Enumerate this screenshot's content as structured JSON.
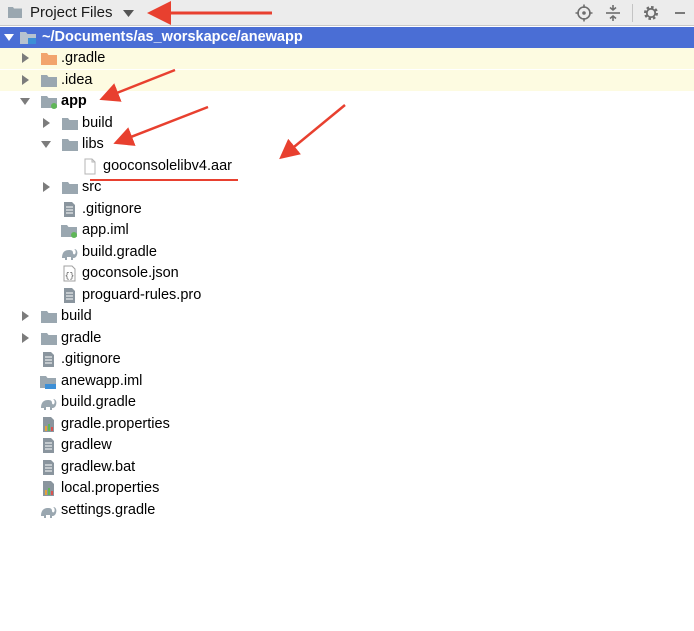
{
  "toolbar": {
    "title": "Project Files",
    "icons": [
      "folder-icon",
      "chevron-down-icon",
      "locate-icon",
      "collapse-all-icon",
      "gear-icon",
      "hide-icon"
    ]
  },
  "tree": {
    "root": "~/Documents/as_worskapce/anewapp",
    "idea_gradle": ".gradle",
    "idea": ".idea",
    "app": "app",
    "app_build": "build",
    "libs": "libs",
    "aar": "gooconsolelibv4.aar",
    "src": "src",
    "app_gitignore": ".gitignore",
    "app_iml": "app.iml",
    "app_build_gradle": "build.gradle",
    "goconsole": "goconsole.json",
    "proguard": "proguard-rules.pro",
    "build": "build",
    "gradle": "gradle",
    "gitignore": ".gitignore",
    "anewapp_iml": "anewapp.iml",
    "build_gradle": "build.gradle",
    "gradle_properties": "gradle.properties",
    "gradlew": "gradlew",
    "gradlew_bat": "gradlew.bat",
    "local_properties": "local.properties",
    "settings_gradle": "settings.gradle"
  },
  "colors": {
    "selection": "#4a6ed5",
    "ignored_background": "#fdfbe1",
    "annotation": "#e8402f",
    "folder": "#9aa7b0",
    "folder_orange": "#f2a46d"
  }
}
